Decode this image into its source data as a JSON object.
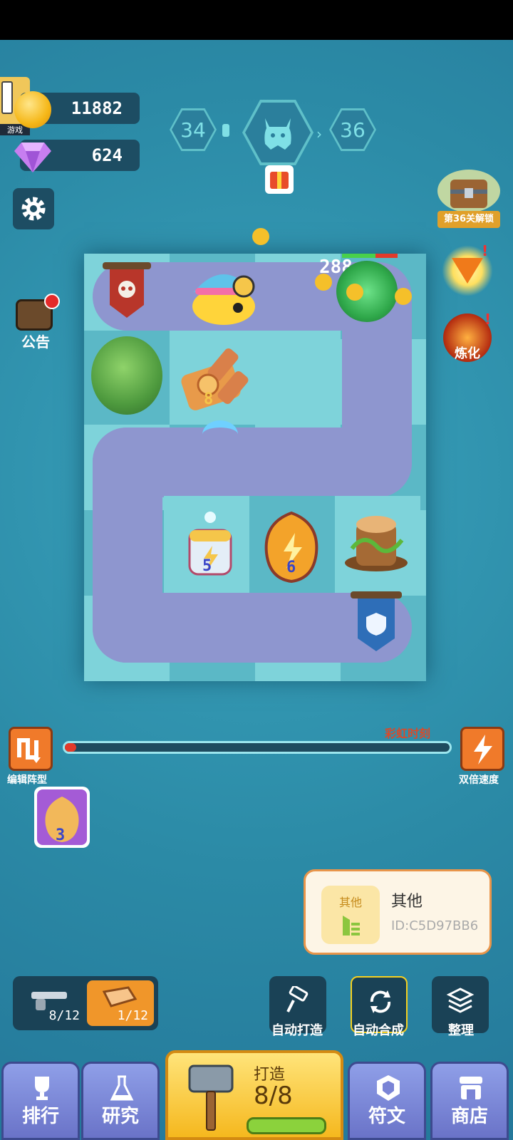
{
  "currency": {
    "coins": "11882",
    "gems": "624"
  },
  "mini_game_label": "游戏",
  "level": {
    "prev": "34",
    "next": "36"
  },
  "right_panel": {
    "chest_label": "第36关解锁",
    "refine_label": "炼化"
  },
  "notice_label": "公告",
  "board": {
    "enemy_hp": "288",
    "towers": [
      {
        "name": "cannon",
        "level": "8"
      },
      {
        "name": "lightning-tower",
        "level": "5"
      },
      {
        "name": "lightning-egg",
        "level": "6"
      }
    ]
  },
  "controls": {
    "edit_formation": "编辑阵型",
    "double_speed": "双倍速度",
    "rainbow_time": "彩虹时刻",
    "wave_progress": 0.03
  },
  "rune_slot_level": "3",
  "popup": {
    "category": "其他",
    "title": "其他",
    "id": "ID:C5D97BB6"
  },
  "tools": {
    "left_count": "8/12",
    "right_count": "1/12",
    "auto_forge": "自动打造",
    "auto_merge": "自动合成",
    "organize": "整理"
  },
  "nav": {
    "rank": "排行",
    "research": "研究",
    "forge_title": "打造",
    "forge_count": "8/8",
    "rune": "符文",
    "shop": "商店"
  },
  "colors": {
    "accent": "#f07a2a",
    "board_path": "#8e96cf",
    "forge": "#f5b81e"
  }
}
